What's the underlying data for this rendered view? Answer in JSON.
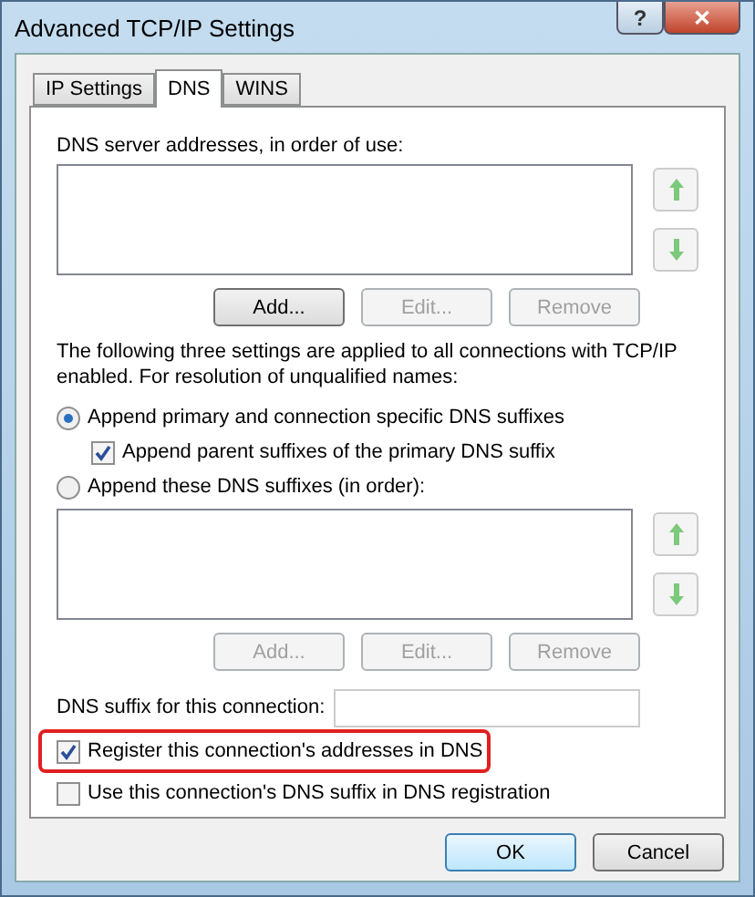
{
  "window": {
    "title": "Advanced TCP/IP Settings",
    "help": "?",
    "close": "✕"
  },
  "tabs": [
    {
      "label": "IP Settings",
      "selected": false
    },
    {
      "label": "DNS",
      "selected": true
    },
    {
      "label": "WINS",
      "selected": false
    }
  ],
  "dns_servers": {
    "label": "DNS server addresses, in order of use:",
    "buttons": [
      {
        "label": "Add...",
        "disabled": false
      },
      {
        "label": "Edit...",
        "disabled": true
      },
      {
        "label": "Remove",
        "disabled": true
      }
    ]
  },
  "info": "The following three settings are applied to all connections with TCP/IP enabled. For resolution of unqualified names:",
  "suffix_options": [
    {
      "kind": "radio",
      "label": "Append primary and connection specific DNS suffixes",
      "selected": true
    },
    {
      "kind": "checkbox",
      "label": "Append parent suffixes of the primary DNS suffix",
      "checked": true
    },
    {
      "kind": "radio",
      "label": "Append these DNS suffixes (in order):",
      "selected": false
    }
  ],
  "suffix_list": {
    "buttons": [
      {
        "label": "Add...",
        "disabled": true
      },
      {
        "label": "Edit...",
        "disabled": true
      },
      {
        "label": "Remove",
        "disabled": true
      }
    ]
  },
  "connection_suffix": {
    "label": "DNS suffix for this connection:"
  },
  "registration": [
    {
      "label": "Register this connection's addresses in DNS",
      "checked": true,
      "highlighted": true
    },
    {
      "label": "Use this connection's DNS suffix in DNS registration",
      "checked": false,
      "highlighted": false
    }
  ],
  "buttons": [
    {
      "label": "OK",
      "default": true
    },
    {
      "label": "Cancel",
      "default": false
    }
  ]
}
